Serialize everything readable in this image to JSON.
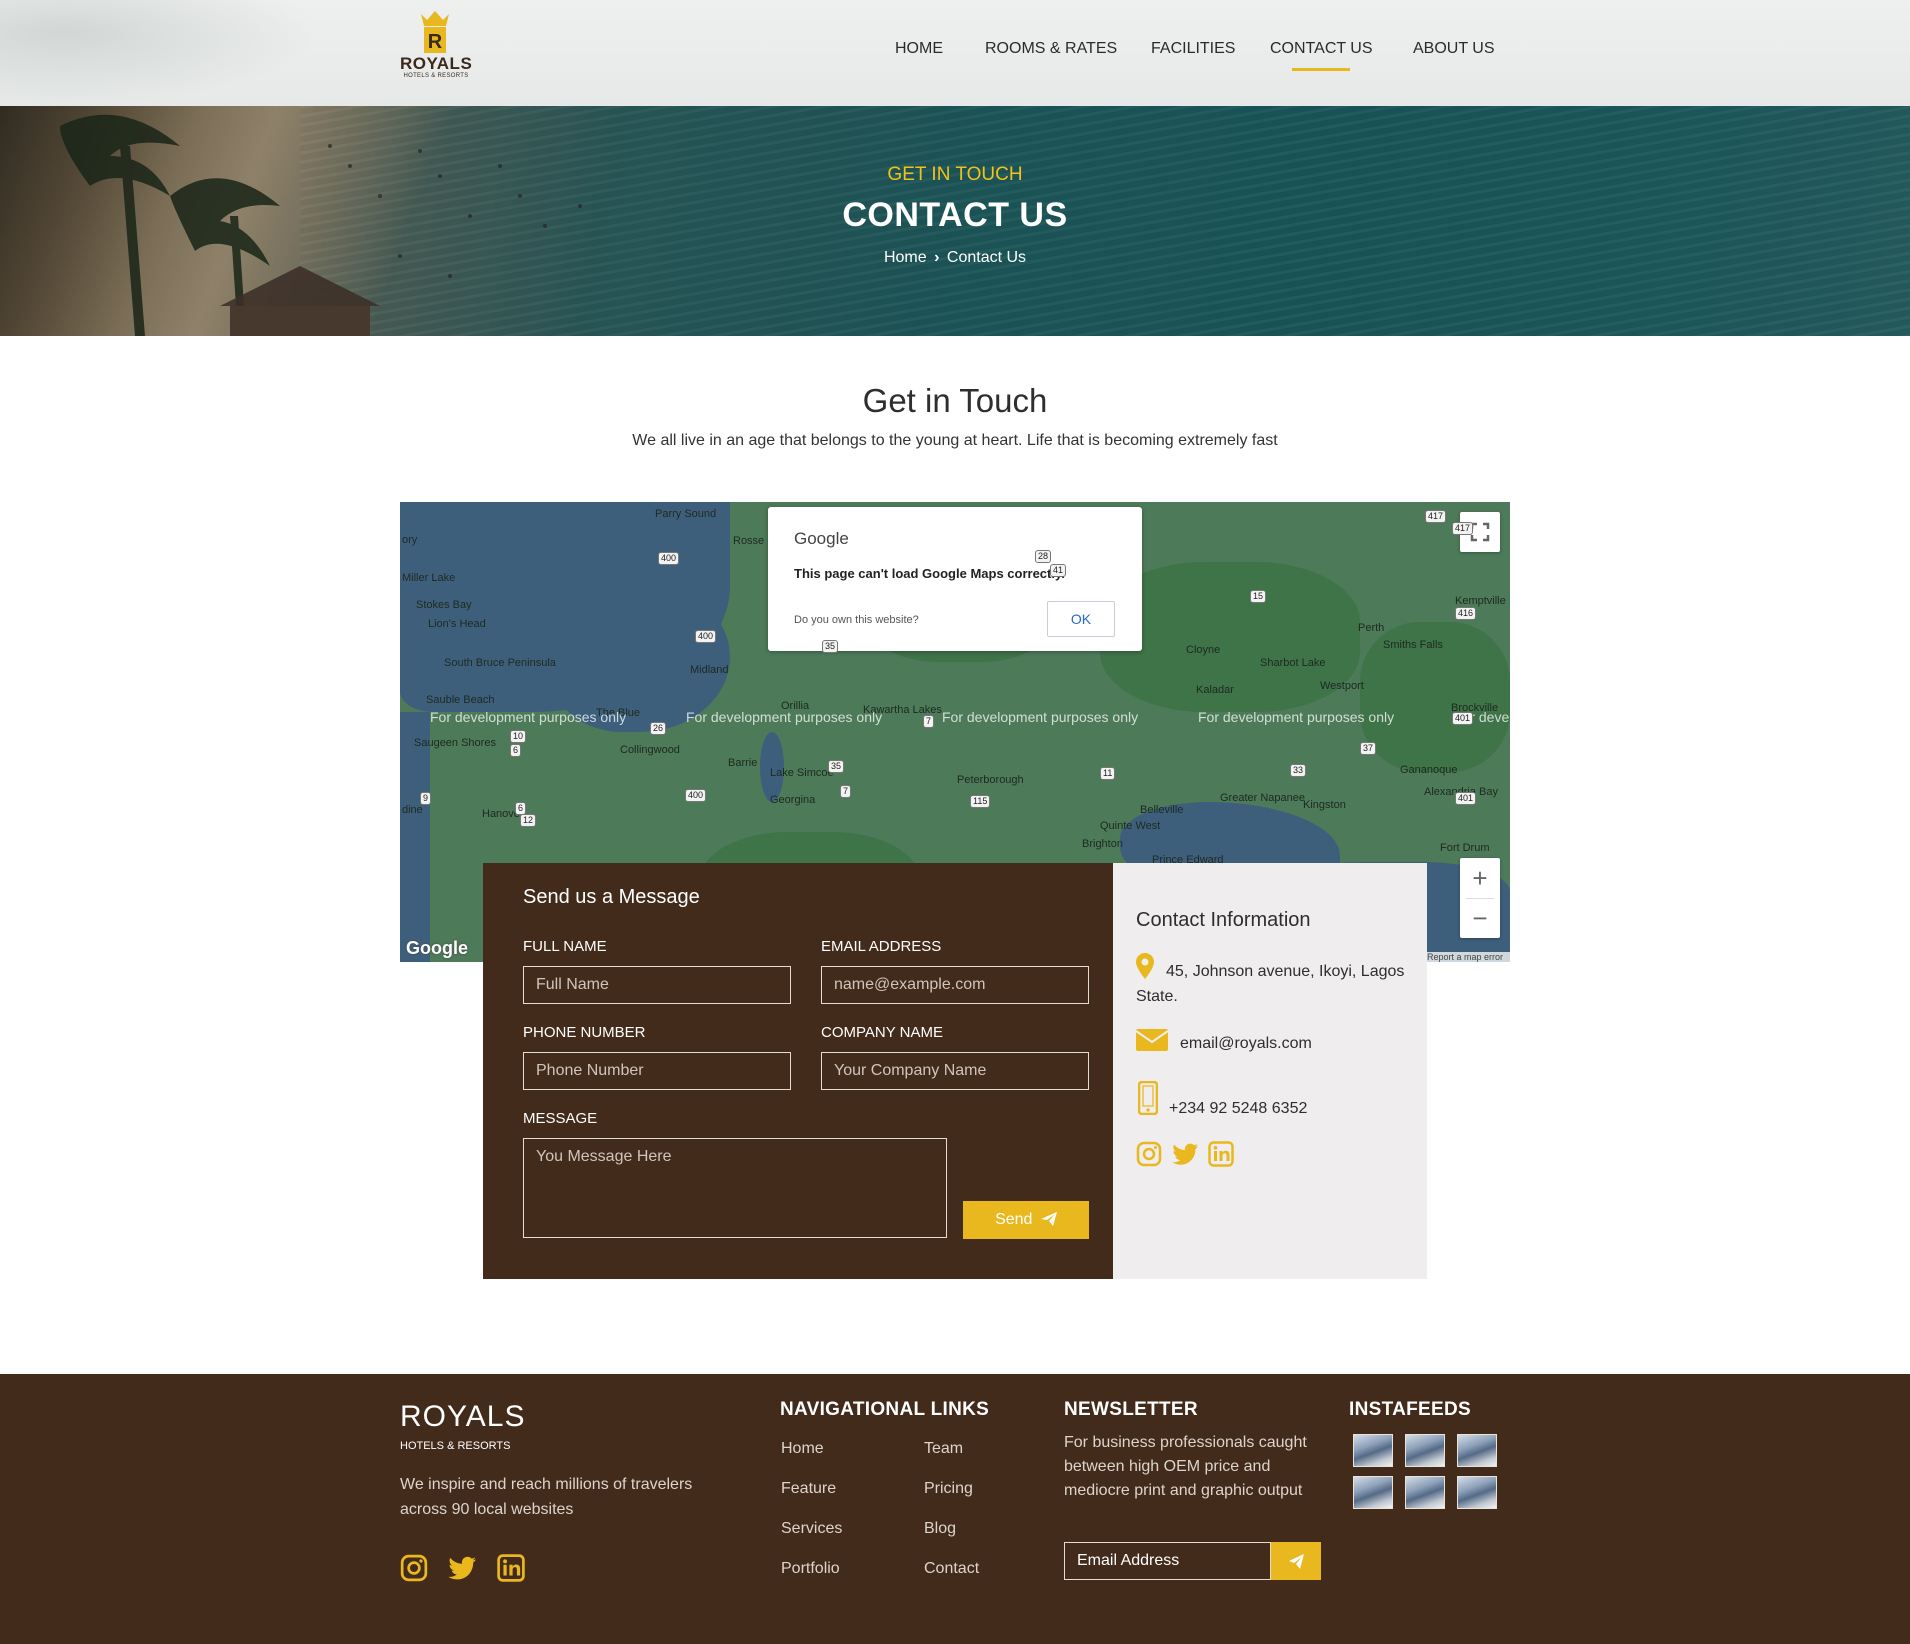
{
  "brand": {
    "name": "ROYALS",
    "tagline": "HOTELS & RESORTS",
    "logo_letter": "R"
  },
  "nav": {
    "items": [
      {
        "label": "HOME",
        "active": false
      },
      {
        "label": "ROOMS & RATES",
        "active": false
      },
      {
        "label": "FACILITIES",
        "active": false
      },
      {
        "label": "CONTACT US",
        "active": true
      },
      {
        "label": "ABOUT US",
        "active": false
      }
    ]
  },
  "hero": {
    "kicker": "GET IN TOUCH",
    "title": "CONTACT US",
    "breadcrumb": {
      "home": "Home",
      "separator_icon": "chevron-right-icon",
      "current": "Contact Us"
    }
  },
  "section": {
    "title": "Get in Touch",
    "subtitle": "We all live in an age that belongs to the young at heart. Life that is becoming extremely fast"
  },
  "map": {
    "dialog": {
      "brand": "Google",
      "message": "This page can't load Google Maps correctly.",
      "question": "Do you own this website?",
      "ok_label": "OK"
    },
    "watermark": "For development purposes only",
    "watermark_cut": "For deve",
    "google_logo": "Google",
    "report": "Report a map error",
    "zoom_in": "+",
    "zoom_out": "−",
    "places": [
      "Parry Sound",
      "Rosse",
      "Miller Lake",
      "Stokes Bay",
      "Lion's Head",
      "South Bruce Peninsula",
      "Sauble Beach",
      "The Blue",
      "Saugeen Shores",
      "Midland",
      "Orillia",
      "Kawartha Lakes",
      "Collingwood",
      "Barrie",
      "Lake Simcoe",
      "Georgina",
      "Hanover",
      "Peterborough",
      "Belleville",
      "Quinte West",
      "Brighton",
      "Prince Edward",
      "Cloyne",
      "Kaladar",
      "Sharbot Lake",
      "Westport",
      "Perth",
      "Smiths Falls",
      "Kemptville",
      "Brockville",
      "Gananoque",
      "Alexandria Bay",
      "Kingston",
      "Greater Napanee",
      "Fort Drum",
      "ory",
      "dine"
    ],
    "routes": [
      "400",
      "400",
      "400",
      "35",
      "35",
      "7",
      "7",
      "28",
      "41",
      "15",
      "416",
      "401",
      "37",
      "33",
      "11",
      "115",
      "26",
      "10",
      "6",
      "9",
      "6",
      "12",
      "417",
      "417",
      "401"
    ]
  },
  "form": {
    "title": "Send us a Message",
    "full_name": {
      "label": "FULL NAME",
      "placeholder": "Full Name"
    },
    "email": {
      "label": "EMAIL ADDRESS",
      "placeholder": "name@example.com"
    },
    "phone": {
      "label": "PHONE NUMBER",
      "placeholder": "Phone Number"
    },
    "company": {
      "label": "COMPANY NAME",
      "placeholder": "Your Company Name"
    },
    "message": {
      "label": "MESSAGE",
      "placeholder": "You Message Here"
    },
    "send_label": "Send"
  },
  "contact_info": {
    "title": "Contact Information",
    "address": "45, Johnson avenue, Ikoyi, Lagos State.",
    "email": "email@royals.com",
    "phone": "+234 92 5248 6352",
    "social": [
      "instagram-icon",
      "twitter-icon",
      "linkedin-icon"
    ]
  },
  "footer": {
    "brand": "ROYALS",
    "brand_sub": "HOTELS & RESORTS",
    "description": "We inspire and reach millions of travelers across 90 local websites",
    "social": [
      "instagram-icon",
      "twitter-icon",
      "linkedin-icon"
    ],
    "nav_heading": "NAVIGATIONAL LINKS",
    "nav_links_col1": [
      "Home",
      "Feature",
      "Services",
      "Portfolio"
    ],
    "nav_links_col2": [
      "Team",
      "Pricing",
      "Blog",
      "Contact"
    ],
    "newsletter_heading": "NEWSLETTER",
    "newsletter_text": "For business professionals caught between high OEM price and mediocre print and graphic output",
    "newsletter_placeholder": "Email Address",
    "insta_heading": "INSTAFEEDS"
  },
  "colors": {
    "accent": "#e8b81e",
    "brown": "#432b1c",
    "panel": "#efeded"
  }
}
